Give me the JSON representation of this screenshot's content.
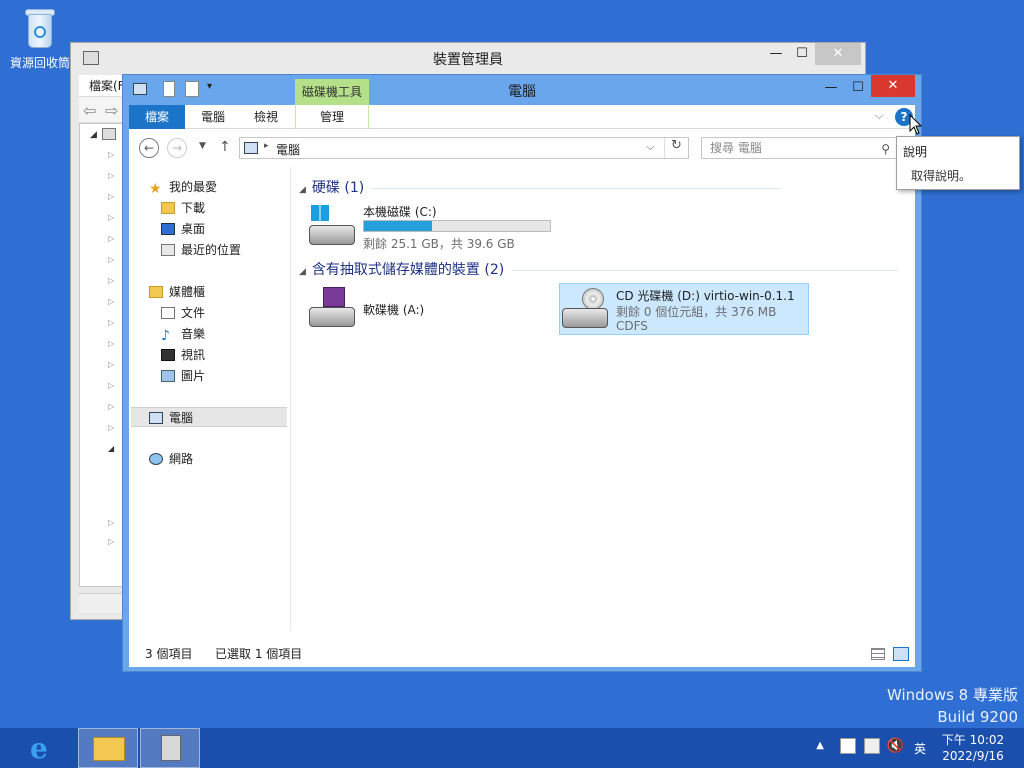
{
  "desktop": {
    "recycle_bin_label": "資源回收筒",
    "watermark_line1": "Windows 8 專業版",
    "watermark_line2": "Build 9200"
  },
  "device_manager": {
    "title": "裝置管理員",
    "menu_file": "檔案(F",
    "controls": {
      "minimize": "—",
      "maximize": "☐",
      "close": "✕"
    }
  },
  "explorer": {
    "title": "電腦",
    "context_tab_group": "磁碟機工具",
    "ribbon_tabs": [
      "檔案",
      "電腦",
      "檢視",
      "管理"
    ],
    "address_path": "電腦",
    "search_placeholder": "搜尋 電腦",
    "nav": {
      "favorites": "我的最愛",
      "downloads": "下載",
      "desktop": "桌面",
      "recent": "最近的位置",
      "libraries": "媒體櫃",
      "documents": "文件",
      "music": "音樂",
      "videos": "視訊",
      "pictures": "圖片",
      "computer": "電腦",
      "network": "網路"
    },
    "sections": {
      "hdd": "硬碟 (1)",
      "removable": "含有抽取式儲存媒體的裝置 (2)"
    },
    "drives": {
      "c": {
        "name": "本機磁碟 (C:)",
        "free": "剩餘 25.1 GB，共 39.6 GB",
        "used_fraction": 0.366
      },
      "a": {
        "name": "軟碟機 (A:)"
      },
      "d": {
        "name": "CD 光碟機 (D:) virtio-win-0.1.1",
        "free": "剩餘 0 個位元組，共 376 MB",
        "fs": "CDFS"
      }
    },
    "status": {
      "items": "3 個項目",
      "selected": "已選取 1 個項目"
    }
  },
  "help_popup": {
    "title": "說明",
    "subtitle": "取得說明。"
  },
  "taskbar": {
    "tray_ime": "英",
    "clock_time": "下午 10:02",
    "clock_date": "2022/9/16"
  },
  "colors": {
    "desktop": "#2f6fd3",
    "accent": "#1c74c9",
    "context_tab": "#b5e08a",
    "selection": "#cce8ff"
  }
}
